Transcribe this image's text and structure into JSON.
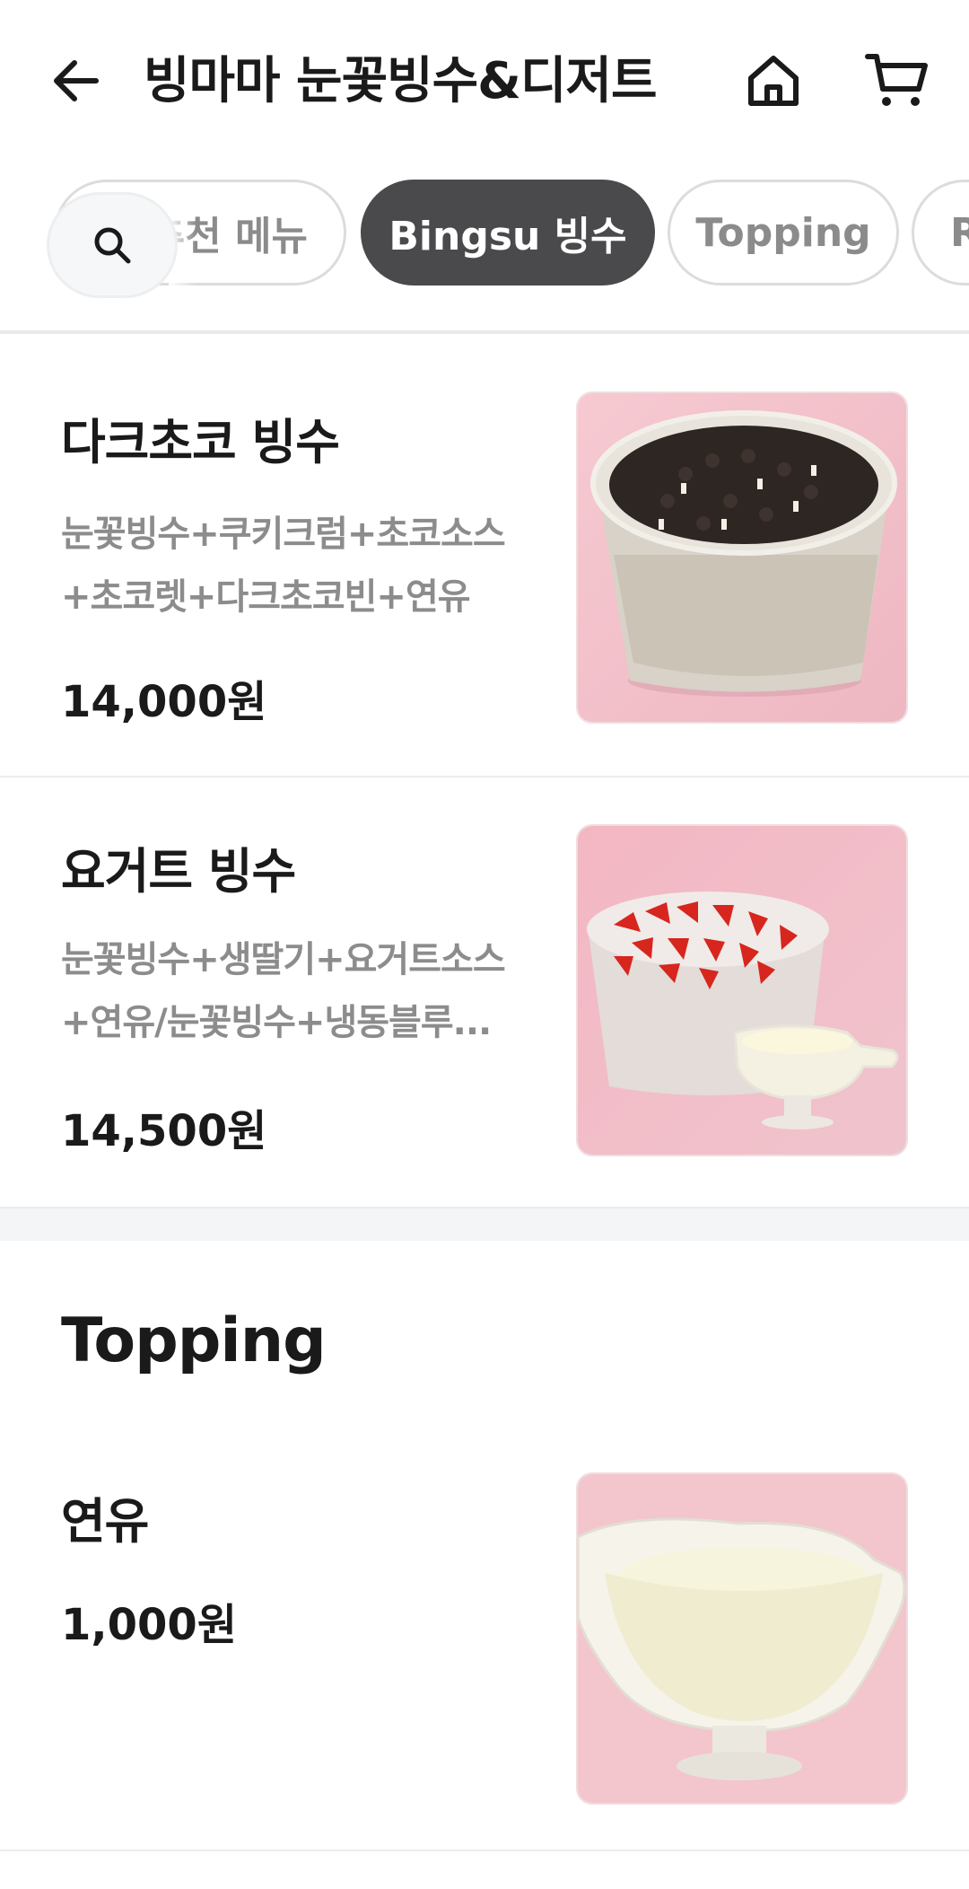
{
  "header": {
    "title": "빙마마 눈꽃빙수&디저트",
    "back_icon": "arrow-left-icon",
    "home_icon": "home-icon",
    "cart_icon": "cart-icon"
  },
  "tabs": [
    {
      "label": "추천 메뉴",
      "active": false
    },
    {
      "label": "Bingsu 빙수",
      "active": true
    },
    {
      "label": "Topping",
      "active": false
    },
    {
      "label": "R",
      "active": false
    }
  ],
  "sections": [
    {
      "items": [
        {
          "name": "다크초코 빙수",
          "desc_line1": "눈꽃빙수+쿠키크럼+초코소스",
          "desc_line2": "+초코렛+다크초코빈+연유",
          "price": "14,000원",
          "image": "dark-choco-bingsu-photo"
        },
        {
          "name": "요거트 빙수",
          "desc_line1": "눈꽃빙수+생딸기+요거트소스",
          "desc_line2": "+연유/눈꽃빙수+냉동블루...",
          "price": "14,500원",
          "image": "yogurt-bingsu-photo"
        }
      ]
    },
    {
      "title": "Topping",
      "items": [
        {
          "name": "연유",
          "price": "1,000원",
          "image": "condensed-milk-photo"
        }
      ]
    }
  ],
  "colors": {
    "active_tab_bg": "#4a4a4c",
    "text_primary": "#1a1a1a",
    "text_secondary": "#8c8c8c",
    "image_bg_pink": "#f2c4cc"
  }
}
